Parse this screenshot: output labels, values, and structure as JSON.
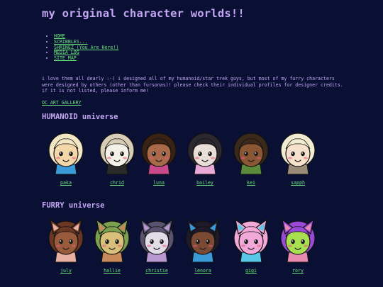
{
  "title": "my original character worlds!!",
  "nav": [
    {
      "label": "HOME"
    },
    {
      "label": "SCRIBBLES..."
    },
    {
      "label": "SHRINEZ (You Are Here!)"
    },
    {
      "label": "MEDIA LOG"
    },
    {
      "label": "SITE MAP"
    }
  ],
  "intro": "i love them all dearly :-( i designed all of my humanoid/star trek guys, but most of my furry characters were designed by others (other than fursonas)! please check their individual profiles for designer credits. if it is not listed, please inform me!",
  "gallery_link": "OC ART GALLERY",
  "humanoid": {
    "title": "HUMANOID universe",
    "characters": [
      {
        "name": "paka",
        "skin": "#f3d7a8",
        "hair": "#f2e6c4",
        "accent": "#3a9bd8"
      },
      {
        "name": "chrid",
        "skin": "#f4f1e8",
        "hair": "#d8cdb6",
        "accent": "#2a2a2a"
      },
      {
        "name": "luna",
        "skin": "#a86a48",
        "hair": "#3a2314",
        "accent": "#c84a8a"
      },
      {
        "name": "bailey",
        "skin": "#e9dfd8",
        "hair": "#2c2830",
        "accent": "#e8a8d8"
      },
      {
        "name": "kei",
        "skin": "#8a5634",
        "hair": "#3b2a1c",
        "accent": "#5a8a3a"
      },
      {
        "name": "sapph",
        "skin": "#f6e2cc",
        "hair": "#f4ecd2",
        "accent": "#9a8a78"
      }
    ]
  },
  "furry": {
    "title": "FURRY universe",
    "characters": [
      {
        "name": "july",
        "skin": "#9a5a3c",
        "hair": "#6a3824",
        "accent": "#e8b0a0"
      },
      {
        "name": "hallie",
        "skin": "#d8c07a",
        "hair": "#7aa050",
        "accent": "#c88a5a"
      },
      {
        "name": "christie",
        "skin": "#e2dce8",
        "hair": "#5a5470",
        "accent": "#b898d0"
      },
      {
        "name": "lenora",
        "skin": "#7a4a34",
        "hair": "#1e1a2a",
        "accent": "#3a9ad8"
      },
      {
        "name": "gigi",
        "skin": "#f2a8d8",
        "hair": "#f2a8d8",
        "accent": "#58c8e8"
      },
      {
        "name": "rory",
        "skin": "#a8e050",
        "hair": "#9a4ad8",
        "accent": "#e88ab0"
      }
    ]
  },
  "colors": {
    "background": "#0a1034",
    "text": "#c3a6f2",
    "link": "#6de57d"
  }
}
